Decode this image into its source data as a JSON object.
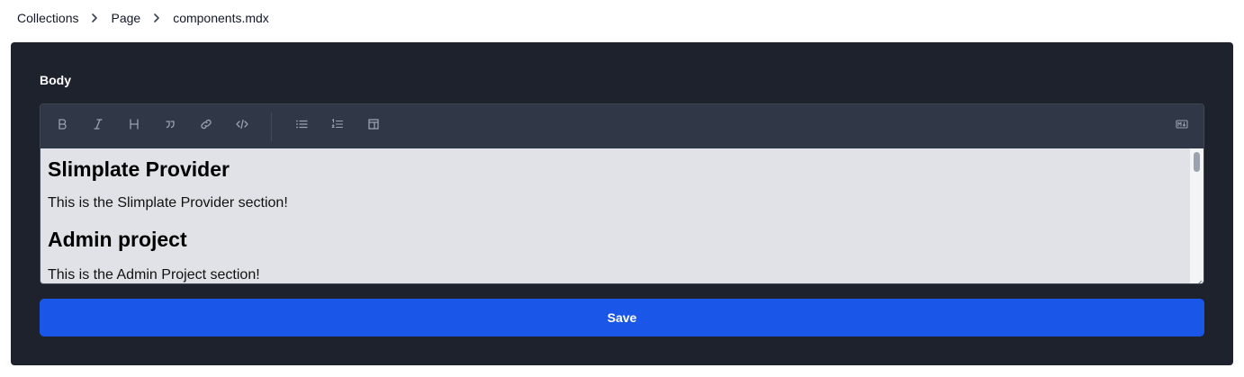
{
  "breadcrumb": {
    "items": [
      "Collections",
      "Page",
      "components.mdx"
    ]
  },
  "form": {
    "field_label": "Body",
    "toolbar": {
      "buttons": [
        "bold-icon",
        "italic-icon",
        "heading-icon",
        "quote-icon",
        "link-icon",
        "code-icon",
        "bullet-list-icon",
        "ordered-list-icon",
        "table-icon",
        "markdown-icon"
      ]
    },
    "content": {
      "heading1": "Slimplate Provider",
      "paragraph1": "This is the Slimplate Provider section!",
      "heading2": "Admin project",
      "paragraph2": "This is the Admin Project section!"
    },
    "save_label": "Save"
  },
  "colors": {
    "card_bg": "#1e222d",
    "toolbar_bg": "#303746",
    "editor_bg": "#e0e2e7",
    "save_button": "#1a56e8"
  }
}
